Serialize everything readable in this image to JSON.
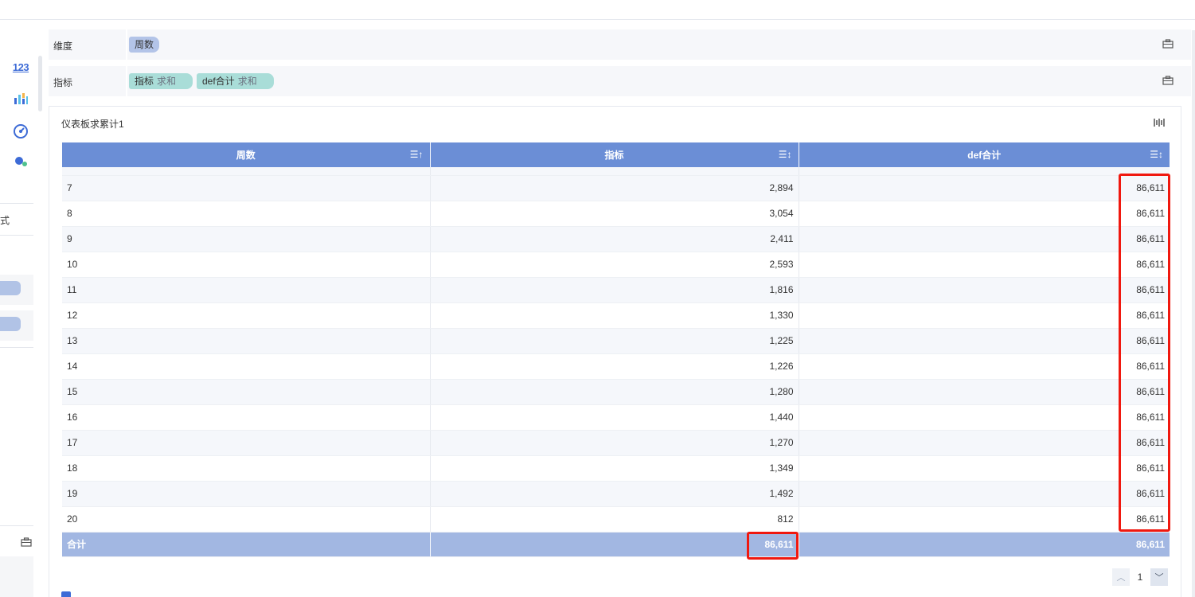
{
  "fields": {
    "dimension_label": "维度",
    "dimension_pill": "周数",
    "measure_label": "指标",
    "measure_pills": [
      {
        "name": "指标",
        "agg": "求和"
      },
      {
        "name": "def合计",
        "agg": "求和"
      }
    ]
  },
  "left_panel": {
    "number_icon_text": "123",
    "style_text": "式"
  },
  "widget": {
    "title": "仪表板求累计1"
  },
  "table": {
    "columns": [
      "周数",
      "指标",
      "def合计"
    ],
    "rows": [
      {
        "week": "7",
        "metric": "2,894",
        "def_total": "86,611"
      },
      {
        "week": "8",
        "metric": "3,054",
        "def_total": "86,611"
      },
      {
        "week": "9",
        "metric": "2,411",
        "def_total": "86,611"
      },
      {
        "week": "10",
        "metric": "2,593",
        "def_total": "86,611"
      },
      {
        "week": "11",
        "metric": "1,816",
        "def_total": "86,611"
      },
      {
        "week": "12",
        "metric": "1,330",
        "def_total": "86,611"
      },
      {
        "week": "13",
        "metric": "1,225",
        "def_total": "86,611"
      },
      {
        "week": "14",
        "metric": "1,226",
        "def_total": "86,611"
      },
      {
        "week": "15",
        "metric": "1,280",
        "def_total": "86,611"
      },
      {
        "week": "16",
        "metric": "1,440",
        "def_total": "86,611"
      },
      {
        "week": "17",
        "metric": "1,270",
        "def_total": "86,611"
      },
      {
        "week": "18",
        "metric": "1,349",
        "def_total": "86,611"
      },
      {
        "week": "19",
        "metric": "1,492",
        "def_total": "86,611"
      },
      {
        "week": "20",
        "metric": "812",
        "def_total": "86,611"
      }
    ],
    "total": {
      "label": "合计",
      "metric": "86,611",
      "def_total": "86,611"
    }
  },
  "pagination": {
    "current_page": "1"
  },
  "colors": {
    "header": "#6b8ed6",
    "total_row": "#a2b7e2",
    "highlight": "#f0180f",
    "dimension_pill": "#b3c4e8",
    "measure_pill": "#a9ddd8"
  },
  "icons": [
    "number-type-icon",
    "bar-chart-icon",
    "gauge-icon",
    "dot-scatter-icon",
    "toolbox-icon",
    "column-settings-icon",
    "sort-icon",
    "chevron-up-icon",
    "chevron-down-icon"
  ]
}
